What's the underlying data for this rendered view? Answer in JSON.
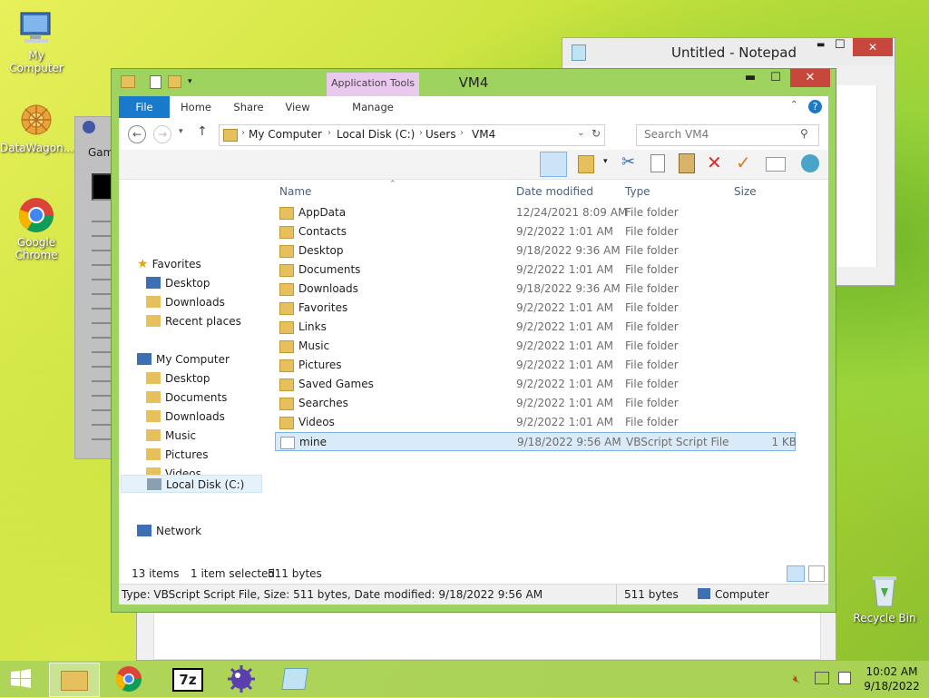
{
  "desktop": {
    "icons": [
      {
        "label": "My Computer"
      },
      {
        "label": "DataWagon..."
      },
      {
        "label": "Google Chrome"
      },
      {
        "label": "Recycle Bin"
      }
    ]
  },
  "notepad": {
    "title": "Untitled - Notepad",
    "min": "▬",
    "max": "☐",
    "close": "✕"
  },
  "minesweeper": {
    "menu": "Gam"
  },
  "explorer": {
    "title": "VM4",
    "app_tools": "Application Tools",
    "tabs": {
      "file": "File",
      "home": "Home",
      "share": "Share",
      "view": "View",
      "manage": "Manage"
    },
    "breadcrumb": [
      "My Computer",
      "Local Disk (C:)",
      "Users",
      "VM4"
    ],
    "search_placeholder": "Search VM4",
    "columns": {
      "name": "Name",
      "date": "Date modified",
      "type": "Type",
      "size": "Size"
    },
    "nav": {
      "favorites": "Favorites",
      "fav_items": [
        "Desktop",
        "Downloads",
        "Recent places"
      ],
      "computer": "My Computer",
      "comp_items": [
        "Desktop",
        "Documents",
        "Downloads",
        "Music",
        "Pictures",
        "Videos",
        "Local Disk (C:)"
      ],
      "network": "Network"
    },
    "files": [
      {
        "name": "AppData",
        "date": "12/24/2021 8:09 AM",
        "type": "File folder",
        "size": ""
      },
      {
        "name": "Contacts",
        "date": "9/2/2022 1:01 AM",
        "type": "File folder",
        "size": ""
      },
      {
        "name": "Desktop",
        "date": "9/18/2022 9:36 AM",
        "type": "File folder",
        "size": ""
      },
      {
        "name": "Documents",
        "date": "9/2/2022 1:01 AM",
        "type": "File folder",
        "size": ""
      },
      {
        "name": "Downloads",
        "date": "9/18/2022 9:36 AM",
        "type": "File folder",
        "size": ""
      },
      {
        "name": "Favorites",
        "date": "9/2/2022 1:01 AM",
        "type": "File folder",
        "size": ""
      },
      {
        "name": "Links",
        "date": "9/2/2022 1:01 AM",
        "type": "File folder",
        "size": ""
      },
      {
        "name": "Music",
        "date": "9/2/2022 1:01 AM",
        "type": "File folder",
        "size": ""
      },
      {
        "name": "Pictures",
        "date": "9/2/2022 1:01 AM",
        "type": "File folder",
        "size": ""
      },
      {
        "name": "Saved Games",
        "date": "9/2/2022 1:01 AM",
        "type": "File folder",
        "size": ""
      },
      {
        "name": "Searches",
        "date": "9/2/2022 1:01 AM",
        "type": "File folder",
        "size": ""
      },
      {
        "name": "Videos",
        "date": "9/2/2022 1:01 AM",
        "type": "File folder",
        "size": ""
      },
      {
        "name": "mine",
        "date": "9/18/2022 9:56 AM",
        "type": "VBScript Script File",
        "size": "1 KB"
      }
    ],
    "status": {
      "count": "13 items",
      "selected": "1 item selected",
      "selected_size": "511 bytes",
      "details": "Type: VBScript Script File, Size: 511 bytes, Date modified: 9/18/2022 9:56 AM",
      "bytes": "511 bytes",
      "location": "Computer"
    }
  },
  "taskbar": {
    "time": "10:02 AM",
    "date": "9/18/2022",
    "sevenzip": "7z"
  }
}
